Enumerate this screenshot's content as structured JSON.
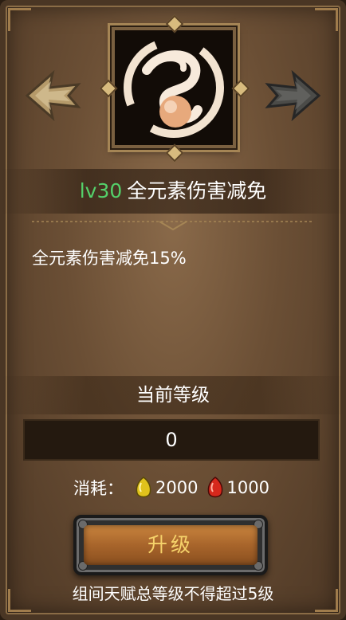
{
  "skill": {
    "level": "lv30",
    "name": "全元素伤害减免",
    "effect": "全元素伤害减免15%",
    "icon": "swirl-skill-icon"
  },
  "navigation": {
    "prev_icon": "arrow-left-icon",
    "next_icon": "arrow-right-icon"
  },
  "current_level": {
    "label": "当前等级",
    "value": "0"
  },
  "cost": {
    "label": "消耗：",
    "items": [
      {
        "icon": "gold-gem-icon",
        "amount": "2000",
        "color": "#e0c21c"
      },
      {
        "icon": "red-gem-icon",
        "amount": "1000",
        "color": "#d6281c"
      }
    ]
  },
  "upgrade_button": {
    "label": "升级"
  },
  "footnote": "组间天赋总等级不得超过5级",
  "colors": {
    "level_green": "#54d06a",
    "button_text": "#f6d36b",
    "panel_brown": "#6b4f35"
  }
}
